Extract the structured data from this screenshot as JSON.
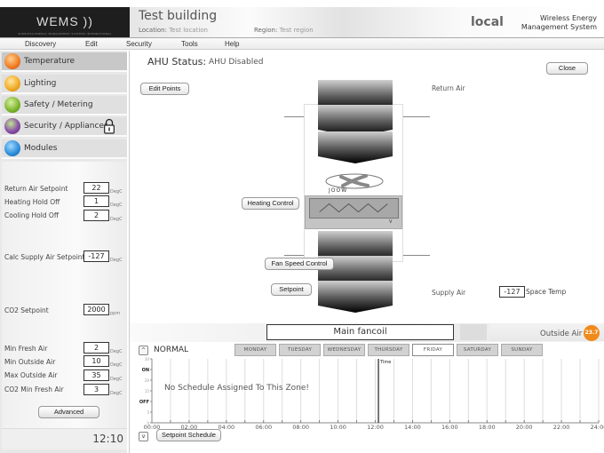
{
  "logo": {
    "text": "WEMS",
    "subtitle": "WIRELESS ENERGY MANAGEMENT SYSTEMS INTERNATIONAL"
  },
  "header": {
    "building": "Test building",
    "location_label": "Location:",
    "location": "Test location",
    "region_label": "Region:",
    "region": "Test region",
    "server": "local",
    "product_line1": "Wireless Energy",
    "product_line2": "Management System"
  },
  "menu": [
    "Discovery",
    "Edit",
    "Security",
    "Tools",
    "Help"
  ],
  "sidebar": {
    "items": [
      {
        "label": "Temperature",
        "icon": "temperature-icon",
        "color": "#f07a20",
        "active": true
      },
      {
        "label": "Lighting",
        "icon": "lighting-icon",
        "color": "#f0a820",
        "active": false
      },
      {
        "label": "Safety / Metering",
        "icon": "safety-icon",
        "color": "#7ab32a",
        "active": false
      },
      {
        "label": "Security / Appliances",
        "icon": "security-icon",
        "color": "#8a4fa8",
        "active": false,
        "locked": true
      },
      {
        "label": "Modules",
        "icon": "modules-icon",
        "color": "#2a8ad8",
        "active": false
      }
    ],
    "params": [
      {
        "label": "Return Air Setpoint",
        "value": "22",
        "unit": "DegC"
      },
      {
        "label": "Heating Hold Off",
        "value": "1",
        "unit": "DegC"
      },
      {
        "label": "Cooling Hold Off",
        "value": "2",
        "unit": "DegC"
      },
      {
        "label": "Calc Supply Air Setpoint",
        "value": "-127",
        "unit": "DegC"
      },
      {
        "label": "CO2 Setpoint",
        "value": "2000",
        "unit": "ppm"
      },
      {
        "label": "Min Fresh Air",
        "value": "2",
        "unit": "DegC"
      },
      {
        "label": "Min Outside Air",
        "value": "10",
        "unit": "DegC"
      },
      {
        "label": "Max Outside Air",
        "value": "35",
        "unit": "DegC"
      },
      {
        "label": "CO2 Min Fresh Air",
        "value": "3",
        "unit": "DegC"
      }
    ],
    "advanced_label": "Advanced",
    "clock": "12:10"
  },
  "ahu": {
    "status_label": "AHU Status:",
    "status_value": "AHU Disabled",
    "close_label": "Close",
    "edit_points_label": "Edit Points",
    "return_air_label": "Return Air",
    "supply_air_label": "Supply Air",
    "heating_control_label": "Heating Control",
    "fan_speed_control_label": "Fan Speed Control",
    "setpoint_label": "Setpoint",
    "fan_text": "JOOW",
    "coil_text": "V",
    "space_temp_value": "-127",
    "space_temp_label": "Space Temp"
  },
  "zone": {
    "name": "Main fancoil",
    "outside_air_label": "Outside Air",
    "outside_air_value": "23.7",
    "mode": "NORMAL",
    "up_label": "^",
    "down_label": "v",
    "days": [
      "MONDAY",
      "TUESDAY",
      "WEDNESDAY",
      "THURSDAY",
      "FRIDAY",
      "SATURDAY",
      "SUNDAY"
    ],
    "selected_day": "FRIDAY",
    "no_schedule_text": "No Schedule Assigned To This Zone!",
    "setpoint_schedule_label": "Setpoint Schedule"
  },
  "chart_data": {
    "type": "line",
    "title": "",
    "xlabel": "",
    "ylabel": "",
    "x_ticks": [
      "00:00",
      "02:00",
      "04:00",
      "06:00",
      "08:00",
      "10:00",
      "12:00",
      "14:00",
      "16:00",
      "18:00",
      "20:00",
      "22:00",
      "24:00"
    ],
    "xlim": [
      0,
      24
    ],
    "y_ticks": [
      {
        "value": 0,
        "label": "0"
      },
      {
        "value": 5,
        "label": "5"
      },
      {
        "value": 10,
        "label": "OFF"
      },
      {
        "value": 15,
        "label": "15"
      },
      {
        "value": 20,
        "label": "20"
      },
      {
        "value": 25,
        "label": "ON"
      },
      {
        "value": 30,
        "label": "30"
      }
    ],
    "ylim": [
      0,
      30
    ],
    "grid": true,
    "series": [],
    "annotations": [
      {
        "x": 12.17,
        "label": "Time"
      }
    ]
  }
}
